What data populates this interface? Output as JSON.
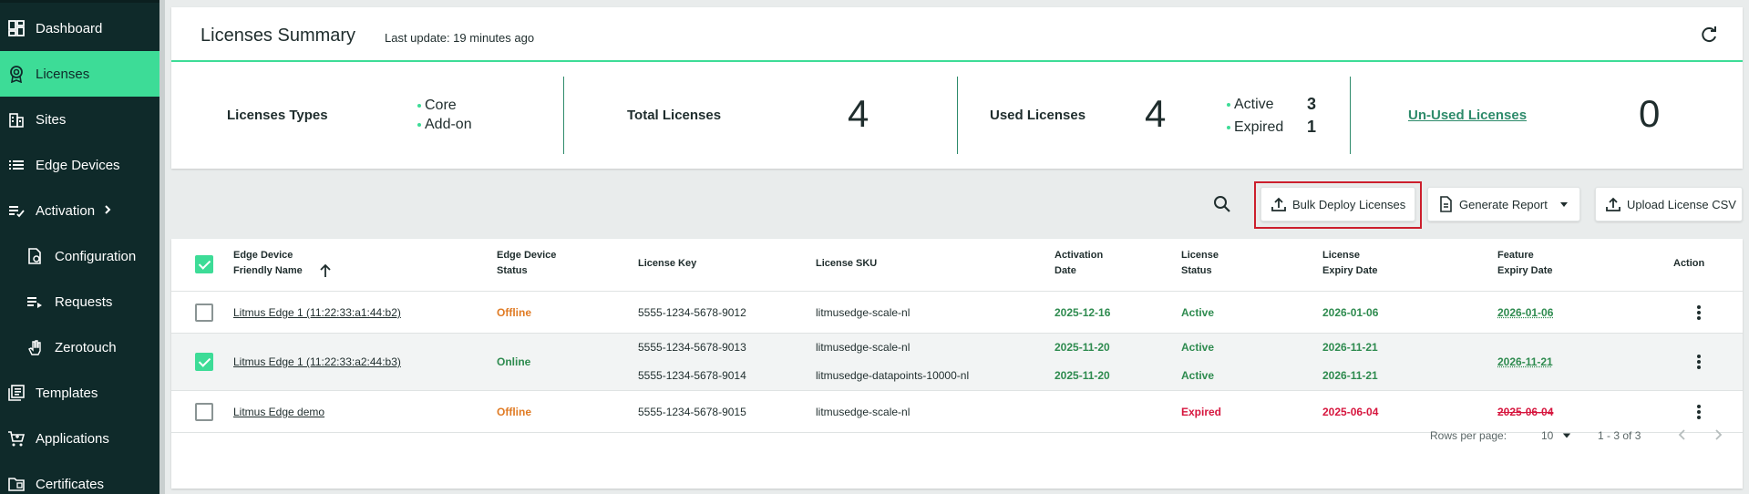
{
  "sidebar": {
    "items": [
      {
        "label": "Dashboard",
        "icon": "dashboard-icon"
      },
      {
        "label": "Licenses",
        "icon": "license-badge-icon",
        "active": true
      },
      {
        "label": "Sites",
        "icon": "building-icon"
      },
      {
        "label": "Edge Devices",
        "icon": "list-icon"
      },
      {
        "label": "Activation",
        "icon": "checklist-icon",
        "chevron": "chevron-right-icon"
      },
      {
        "label": "Configuration",
        "icon": "config-file-icon",
        "sub": true
      },
      {
        "label": "Requests",
        "icon": "requests-list-icon",
        "sub": true
      },
      {
        "label": "Zerotouch",
        "icon": "hand-touch-icon",
        "sub": true
      },
      {
        "label": "Templates",
        "icon": "templates-icon"
      },
      {
        "label": "Applications",
        "icon": "cart-icon"
      },
      {
        "label": "Certificates",
        "icon": "certificate-folder-icon"
      }
    ]
  },
  "summary": {
    "title": "Licenses Summary",
    "last_update": "Last update: 19 minutes ago",
    "types_label": "Licenses Types",
    "types": [
      "Core",
      "Add-on"
    ],
    "total_label": "Total Licenses",
    "total_value": "4",
    "used_label": "Used Licenses",
    "used_value": "4",
    "active_label": "Active",
    "active_value": "3",
    "expired_label": "Expired",
    "expired_value": "1",
    "unused_label": "Un-Used Licenses",
    "unused_value": "0"
  },
  "toolbar": {
    "bulk_deploy": "Bulk Deploy Licenses",
    "generate_report": "Generate Report",
    "upload_csv": "Upload License CSV"
  },
  "table": {
    "headers": {
      "device": [
        "Edge Device",
        "Friendly Name"
      ],
      "status": [
        "Edge Device",
        "Status"
      ],
      "key": "License Key",
      "sku": "License SKU",
      "activation": [
        "Activation",
        "Date"
      ],
      "lstatus": [
        "License",
        "Status"
      ],
      "expiry": [
        "License",
        "Expiry Date"
      ],
      "feature": [
        "Feature",
        "Expiry Date"
      ],
      "action": "Action"
    },
    "rows": [
      {
        "device": "Litmus Edge 1 (11:22:33:a1:44:b2)",
        "status": "Offline",
        "checked": false,
        "licenses": [
          {
            "key": "5555-1234-5678-9012",
            "sku": "litmusedge-scale-nl",
            "activation": "2025-12-16",
            "lstatus": "Active",
            "expiry": "2026-01-06"
          }
        ],
        "feature": "2026-01-06"
      },
      {
        "device": "Litmus Edge 1 (11:22:33:a2:44:b3)",
        "status": "Online",
        "checked": true,
        "licenses": [
          {
            "key": "5555-1234-5678-9013",
            "sku": "litmusedge-scale-nl",
            "activation": "2025-11-20",
            "lstatus": "Active",
            "expiry": "2026-11-21"
          },
          {
            "key": "5555-1234-5678-9014",
            "sku": "litmusedge-datapoints-10000-nl",
            "activation": "2025-11-20",
            "lstatus": "Active",
            "expiry": "2026-11-21"
          }
        ],
        "feature": "2026-11-21"
      },
      {
        "device": "Litmus Edge demo",
        "status": "Offline",
        "checked": false,
        "licenses": [
          {
            "key": "5555-1234-5678-9015",
            "sku": "litmusedge-scale-nl",
            "activation": "",
            "lstatus": "Expired",
            "expiry": "2025-06-04"
          }
        ],
        "feature": "2025-06-04"
      }
    ],
    "footer": {
      "rows_per_page_label": "Rows per page:",
      "rows_per_page_value": "10",
      "range": "1 - 3 of 3"
    }
  },
  "colors": {
    "sidebar_bg": "#0f2a2a",
    "accent": "#3ddc97",
    "online": "#2e8b4f",
    "offline": "#e07b24",
    "expired": "#d6163e",
    "highlight_box": "#cc1f2d"
  }
}
